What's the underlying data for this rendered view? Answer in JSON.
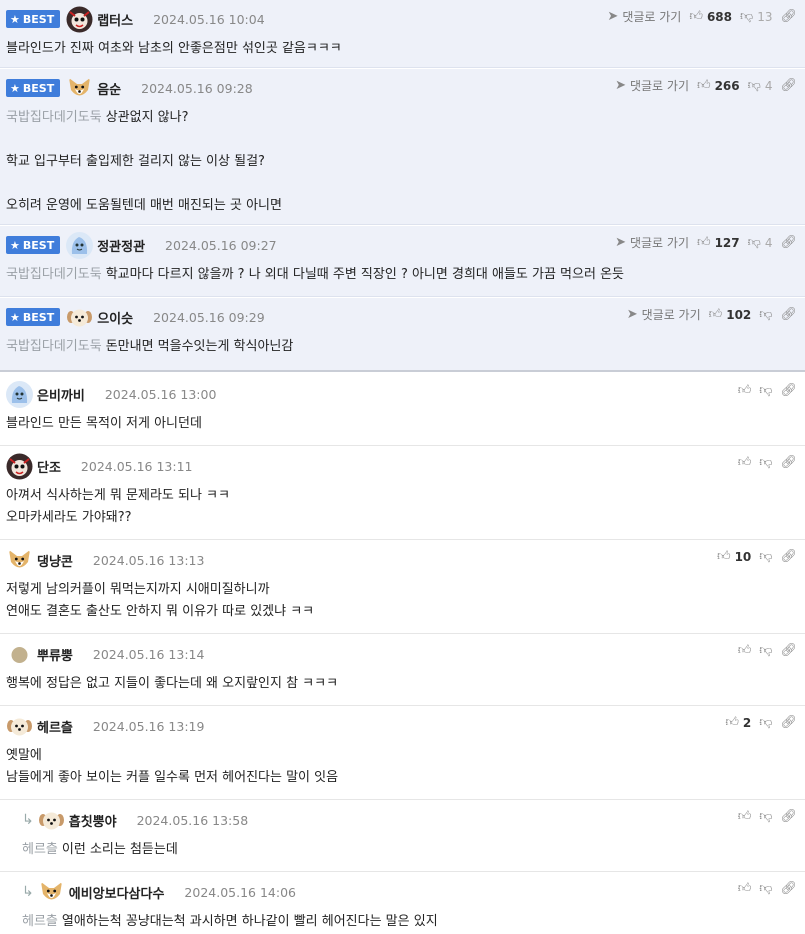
{
  "ui": {
    "best_label": "BEST",
    "goto_label": "댓글로 가기"
  },
  "colors": {
    "best_bg": "#eef1f9",
    "badge_bg": "#3f7ddb",
    "tag_text": "#9aa0a6"
  },
  "comments": [
    {
      "best": true,
      "nick": "랩터스",
      "date": "2024.05.16 10:04",
      "up": "688",
      "down": "13",
      "tag": "",
      "lines": [
        "블라인드가 진짜 여초와 남초의 안좋은점만 섞인곳 같음ㅋㅋㅋ"
      ],
      "avatar": "raptor-avatar"
    },
    {
      "best": true,
      "nick": "음순",
      "date": "2024.05.16 09:28",
      "up": "266",
      "down": "4",
      "tag": "국밥집다데기도둑",
      "lines": [
        "상관없지 않나?",
        "",
        "학교 입구부터 출입제한 걸리지 않는 이상 될걸?",
        "",
        "오히려 운영에 도움될텐데 매번 매진되는 곳 아니면"
      ],
      "avatar": "corgi-avatar"
    },
    {
      "best": true,
      "nick": "정관정관",
      "date": "2024.05.16 09:27",
      "up": "127",
      "down": "4",
      "tag": "국밥집다데기도둑",
      "lines": [
        "학교마다 다르지 않을까 ? 나 외대 다닐때 주변 직장인 ? 아니면 경희대 애들도 가끔 먹으러 온듯"
      ],
      "avatar": "blue-avatar"
    },
    {
      "best": true,
      "nick": "으이슷",
      "date": "2024.05.16 09:29",
      "up": "102",
      "down": "",
      "tag": "국밥집다데기도둑",
      "lines": [
        "돈만내면 먹을수잇는게 학식아닌감"
      ],
      "avatar": "puppy-avatar"
    },
    {
      "best": false,
      "nick": "은비까비",
      "date": "2024.05.16 13:00",
      "up": "",
      "down": "",
      "tag": "",
      "lines": [
        "블라인드 만든 목적이 저게 아니던데"
      ],
      "avatar": "blue-avatar"
    },
    {
      "best": false,
      "nick": "단조",
      "date": "2024.05.16 13:11",
      "up": "",
      "down": "",
      "tag": "",
      "lines": [
        "아껴서 식사하는게 뭐 문제라도 되나 ㅋㅋ",
        "오마카세라도 가야돼??"
      ],
      "avatar": "raptor-avatar"
    },
    {
      "best": false,
      "nick": "댕냥콘",
      "date": "2024.05.16 13:13",
      "up": "10",
      "down": "",
      "tag": "",
      "lines": [
        "저렇게 남의커플이 뭐먹는지까지 시애미질하니까",
        "연애도 결혼도 출산도 안하지 뭐 이유가 따로 있겠냐 ㅋㅋ"
      ],
      "avatar": "corgi-avatar"
    },
    {
      "best": false,
      "nick": "뿌류뿡",
      "date": "2024.05.16 13:14",
      "up": "",
      "down": "",
      "tag": "",
      "lines": [
        "행복에 정답은 없고 지들이 좋다는데 왜 오지랖인지 참 ㅋㅋㅋ"
      ],
      "avatar": "dot-avatar"
    },
    {
      "best": false,
      "nick": "헤르츨",
      "date": "2024.05.16 13:19",
      "up": "2",
      "down": "",
      "tag": "",
      "lines": [
        "옛말에",
        "남들에게 좋아 보이는 커플 일수록 먼저 헤어진다는 말이 잇음"
      ],
      "avatar": "puppy-avatar"
    },
    {
      "best": false,
      "reply": true,
      "nick": "흡칫뿡야",
      "date": "2024.05.16 13:58",
      "up": "",
      "down": "",
      "tag": "헤르츨",
      "lines": [
        "이런 소리는 첨듣는데"
      ],
      "avatar": "puppy-avatar"
    },
    {
      "best": false,
      "reply": true,
      "nick": "에비앙보다삼다수",
      "date": "2024.05.16 14:06",
      "up": "",
      "down": "",
      "tag": "헤르츨",
      "lines": [
        "열애하는척 꽁냥대는척 과시하면 하나같이 빨리 헤어진다는 말은 있지"
      ],
      "avatar": "corgi-avatar"
    }
  ]
}
